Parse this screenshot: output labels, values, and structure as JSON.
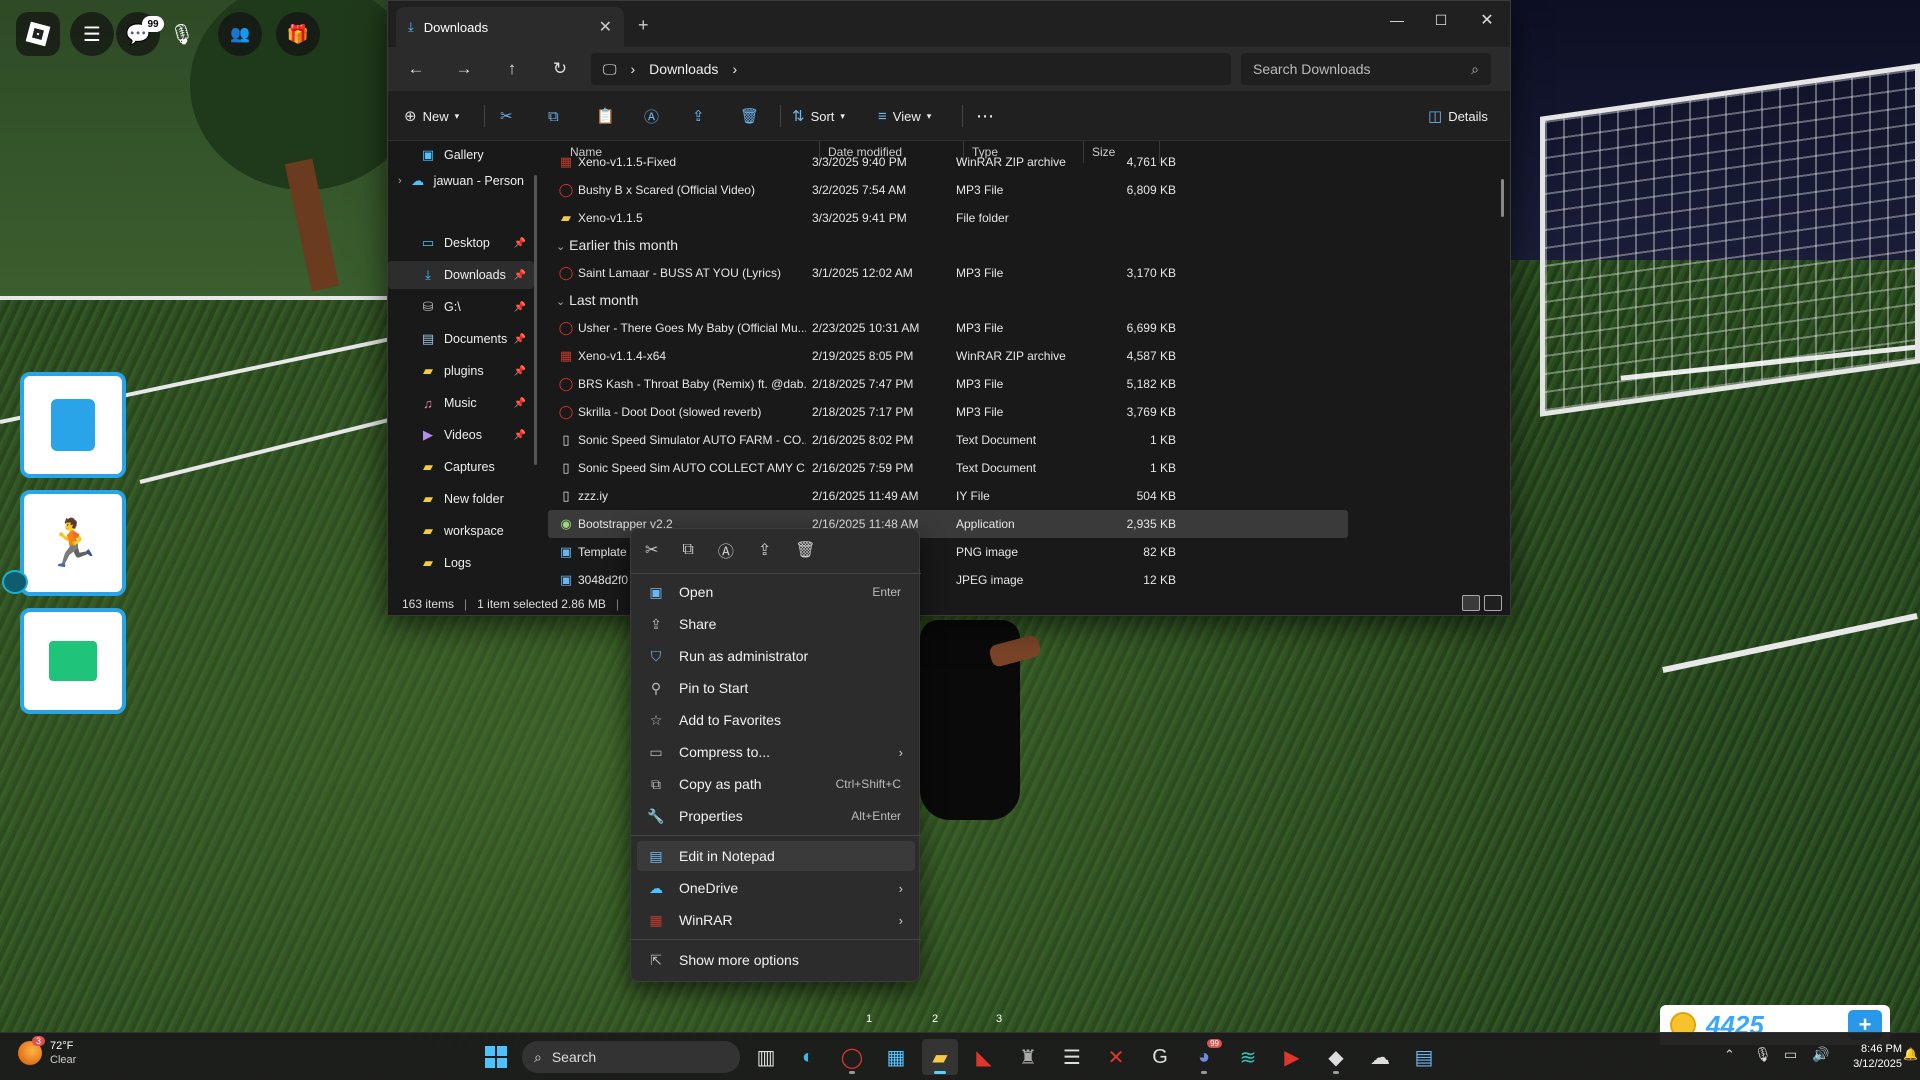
{
  "roblox": {
    "chat_badge": "99",
    "coins": "4425",
    "coins_plus": "+",
    "hotbar_slots": [
      "1",
      "2",
      "3"
    ]
  },
  "explorer": {
    "tab_title": "Downloads",
    "breadcrumb": "Downloads",
    "search_placeholder": "Search Downloads",
    "toolbar": {
      "new_label": "New",
      "sort_label": "Sort",
      "view_label": "View",
      "details_label": "Details"
    },
    "sidebar": [
      {
        "label": "Gallery",
        "icon": "gallery-icon"
      },
      {
        "label": "jawuan - Person",
        "icon": "onedrive-icon"
      },
      {
        "label": "Desktop",
        "icon": "desktop-icon",
        "pinned": true
      },
      {
        "label": "Downloads",
        "icon": "download-icon",
        "pinned": true,
        "selected": true
      },
      {
        "label": "G:\\",
        "icon": "drive-icon",
        "pinned": true
      },
      {
        "label": "Documents",
        "icon": "document-icon",
        "pinned": true
      },
      {
        "label": "plugins",
        "icon": "folder-icon",
        "pinned": true
      },
      {
        "label": "Music",
        "icon": "music-icon",
        "pinned": true
      },
      {
        "label": "Videos",
        "icon": "video-icon",
        "pinned": true
      },
      {
        "label": "Captures",
        "icon": "folder-icon"
      },
      {
        "label": "New folder",
        "icon": "folder-icon"
      },
      {
        "label": "workspace",
        "icon": "folder-icon"
      },
      {
        "label": "Logs",
        "icon": "folder-icon"
      }
    ],
    "columns": {
      "name": "Name",
      "date": "Date modified",
      "type": "Type",
      "size": "Size"
    },
    "groups": {
      "earlier": "Earlier this month",
      "last": "Last month"
    },
    "rows": [
      {
        "name": "Xeno-v1.1.5-Fixed",
        "date": "3/3/2025 9:40 PM",
        "type": "WinRAR ZIP archive",
        "size": "4,761 KB",
        "icon": "winrar-icon"
      },
      {
        "name": "Bushy B x Scared (Official Video)",
        "date": "3/2/2025 7:54 AM",
        "type": "MP3 File",
        "size": "6,809 KB",
        "icon": "opera-icon"
      },
      {
        "name": "Xeno-v1.1.5",
        "date": "3/3/2025 9:41 PM",
        "type": "File folder",
        "size": "",
        "icon": "folder-icon"
      },
      {
        "name": "Saint Lamaar - BUSS AT YOU (Lyrics)",
        "date": "3/1/2025 12:02 AM",
        "type": "MP3 File",
        "size": "3,170 KB",
        "icon": "opera-icon"
      },
      {
        "name": "Usher - There Goes My Baby (Official Mu...",
        "date": "2/23/2025 10:31 AM",
        "type": "MP3 File",
        "size": "6,699 KB",
        "icon": "opera-icon"
      },
      {
        "name": "Xeno-v1.1.4-x64",
        "date": "2/19/2025 8:05 PM",
        "type": "WinRAR ZIP archive",
        "size": "4,587 KB",
        "icon": "winrar-icon"
      },
      {
        "name": "BRS Kash - Throat Baby (Remix) ft. @dab...",
        "date": "2/18/2025 7:47 PM",
        "type": "MP3 File",
        "size": "5,182 KB",
        "icon": "opera-icon"
      },
      {
        "name": "Skrilla - Doot Doot  (slowed  reverb)",
        "date": "2/18/2025 7:17 PM",
        "type": "MP3 File",
        "size": "3,769 KB",
        "icon": "opera-icon"
      },
      {
        "name": "Sonic Speed Simulator AUTO FARM - CO...",
        "date": "2/16/2025 8:02 PM",
        "type": "Text Document",
        "size": "1 KB",
        "icon": "text-file-icon"
      },
      {
        "name": "Sonic Speed Sim AUTO COLLECT AMY C...",
        "date": "2/16/2025 7:59 PM",
        "type": "Text Document",
        "size": "1 KB",
        "icon": "text-file-icon"
      },
      {
        "name": "zzz.iy",
        "date": "2/16/2025 11:49 AM",
        "type": "IY File",
        "size": "504 KB",
        "icon": "file-icon"
      },
      {
        "name": "Bootstrapper v2.2",
        "date": "2/16/2025 11:48 AM",
        "type": "Application",
        "size": "2,935 KB",
        "icon": "app-icon",
        "selected": true
      },
      {
        "name": "Template",
        "date": "",
        "type": "PNG image",
        "size": "82 KB",
        "icon": "image-icon"
      },
      {
        "name": "3048d2f0",
        "date": "",
        "type": "JPEG image",
        "size": "12 KB",
        "icon": "image-icon"
      }
    ],
    "status": {
      "items": "163 items",
      "selected": "1 item selected  2.86 MB"
    }
  },
  "context_menu": {
    "items": [
      {
        "label": "Open",
        "shortcut": "Enter",
        "icon": "open-icon"
      },
      {
        "label": "Share",
        "icon": "share-icon"
      },
      {
        "label": "Run as administrator",
        "icon": "shield-icon"
      },
      {
        "label": "Pin to Start",
        "icon": "pin-icon"
      },
      {
        "label": "Add to Favorites",
        "icon": "star-icon"
      },
      {
        "label": "Compress to...",
        "icon": "zip-icon",
        "submenu": true
      },
      {
        "label": "Copy as path",
        "shortcut": "Ctrl+Shift+C",
        "icon": "path-icon"
      },
      {
        "label": "Properties",
        "shortcut": "Alt+Enter",
        "icon": "wrench-icon"
      },
      {
        "label": "Edit in Notepad",
        "icon": "notepad-icon"
      },
      {
        "label": "OneDrive",
        "icon": "onedrive-icon",
        "submenu": true
      },
      {
        "label": "WinRAR",
        "icon": "winrar-icon",
        "submenu": true
      },
      {
        "label": "Show more options",
        "icon": "more-options-icon"
      }
    ]
  },
  "taskbar": {
    "weather_temp": "72°F",
    "weather_desc": "Clear",
    "weather_badge": "3",
    "search_label": "Search",
    "discord_badge": "99",
    "time": "8:46 PM",
    "date": "3/12/2025"
  },
  "colors": {
    "accent": "#60cdff",
    "explorer_bg": "#191919",
    "menu_bg": "#2c2c2c",
    "roblox_button_border": "#2aa4e8",
    "coin_text": "#3aa6ff"
  }
}
